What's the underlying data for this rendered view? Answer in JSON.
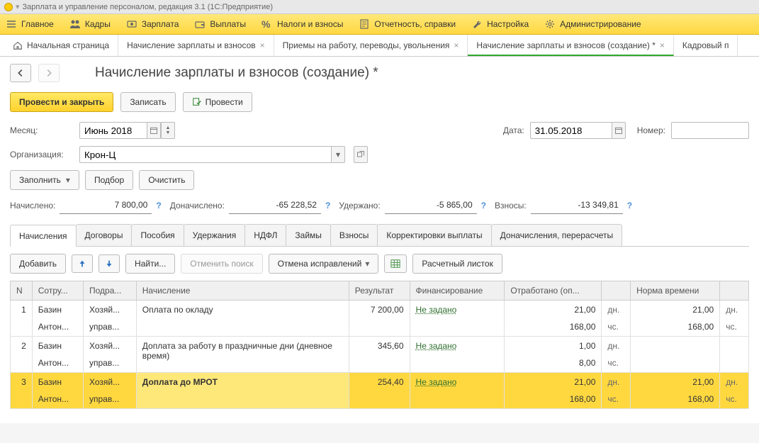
{
  "titlebar": {
    "text": "Зарплата и управление персоналом, редакция 3.1  (1С:Предприятие)"
  },
  "mainmenu": {
    "items": [
      {
        "label": "Главное",
        "icon": "menu"
      },
      {
        "label": "Кадры",
        "icon": "people"
      },
      {
        "label": "Зарплата",
        "icon": "money"
      },
      {
        "label": "Выплаты",
        "icon": "wallet"
      },
      {
        "label": "Налоги и взносы",
        "icon": "percent"
      },
      {
        "label": "Отчетность, справки",
        "icon": "report"
      },
      {
        "label": "Настройка",
        "icon": "wrench"
      },
      {
        "label": "Администрирование",
        "icon": "gear"
      }
    ]
  },
  "subtabs": {
    "items": [
      {
        "label": "Начальная страница",
        "home": true
      },
      {
        "label": "Начисление зарплаты и взносов",
        "close": true
      },
      {
        "label": "Приемы на работу, переводы, увольнения",
        "close": true
      },
      {
        "label": "Начисление зарплаты и взносов (создание) *",
        "close": true,
        "active": true
      },
      {
        "label": "Кадровый п"
      }
    ]
  },
  "page": {
    "title": "Начисление зарплаты и взносов (создание) *",
    "buttons": {
      "post_close": "Провести и закрыть",
      "save": "Записать",
      "post": "Провести"
    },
    "fields": {
      "month_label": "Месяц:",
      "month_value": "Июнь 2018",
      "date_label": "Дата:",
      "date_value": "31.05.2018",
      "number_label": "Номер:",
      "number_value": "",
      "org_label": "Организация:",
      "org_value": "Крон-Ц"
    },
    "actions": {
      "fill": "Заполнить",
      "pick": "Подбор",
      "clear": "Очистить"
    },
    "summary": {
      "accrued_label": "Начислено:",
      "accrued_value": "7 800,00",
      "addl_label": "Доначислено:",
      "addl_value": "-65 228,52",
      "withheld_label": "Удержано:",
      "withheld_value": "-5 865,00",
      "contrib_label": "Взносы:",
      "contrib_value": "-13 349,81"
    },
    "tabs": [
      "Начисления",
      "Договоры",
      "Пособия",
      "Удержания",
      "НДФЛ",
      "Займы",
      "Взносы",
      "Корректировки выплаты",
      "Доначисления, перерасчеты"
    ],
    "active_tab": 0,
    "table_toolbar": {
      "add": "Добавить",
      "find": "Найти...",
      "cancel_find": "Отменить поиск",
      "cancel_fix": "Отмена исправлений",
      "payslip": "Расчетный листок"
    },
    "columns": [
      "N",
      "Сотру...",
      "Подра...",
      "Начисление",
      "Результат",
      "Финансирование",
      "Отработано (оп...",
      "",
      "Норма времени",
      ""
    ],
    "not_set_text": "Не задано",
    "units": {
      "days": "дн.",
      "hours": "чс."
    },
    "rows": [
      {
        "n": "1",
        "emp": "Базин Антон...",
        "dept": "Хозяй... управ...",
        "accr": "Оплата по окладу",
        "result": "7 200,00",
        "worked_d": "21,00",
        "worked_h": "168,00",
        "norm_d": "21,00",
        "norm_h": "168,00"
      },
      {
        "n": "2",
        "emp": "Базин Антон...",
        "dept": "Хозяй... управ...",
        "accr": "Доплата за работу в праздничные дни (дневное время)",
        "result": "345,60",
        "worked_d": "1,00",
        "worked_h": "8,00",
        "norm_d": "",
        "norm_h": ""
      },
      {
        "n": "3",
        "emp": "Базин Антон...",
        "dept": "Хозяй... управ...",
        "accr": "Доплата до МРОТ",
        "result": "254,40",
        "worked_d": "21,00",
        "worked_h": "168,00",
        "norm_d": "21,00",
        "norm_h": "168,00",
        "selected": true,
        "bold": true
      }
    ]
  }
}
